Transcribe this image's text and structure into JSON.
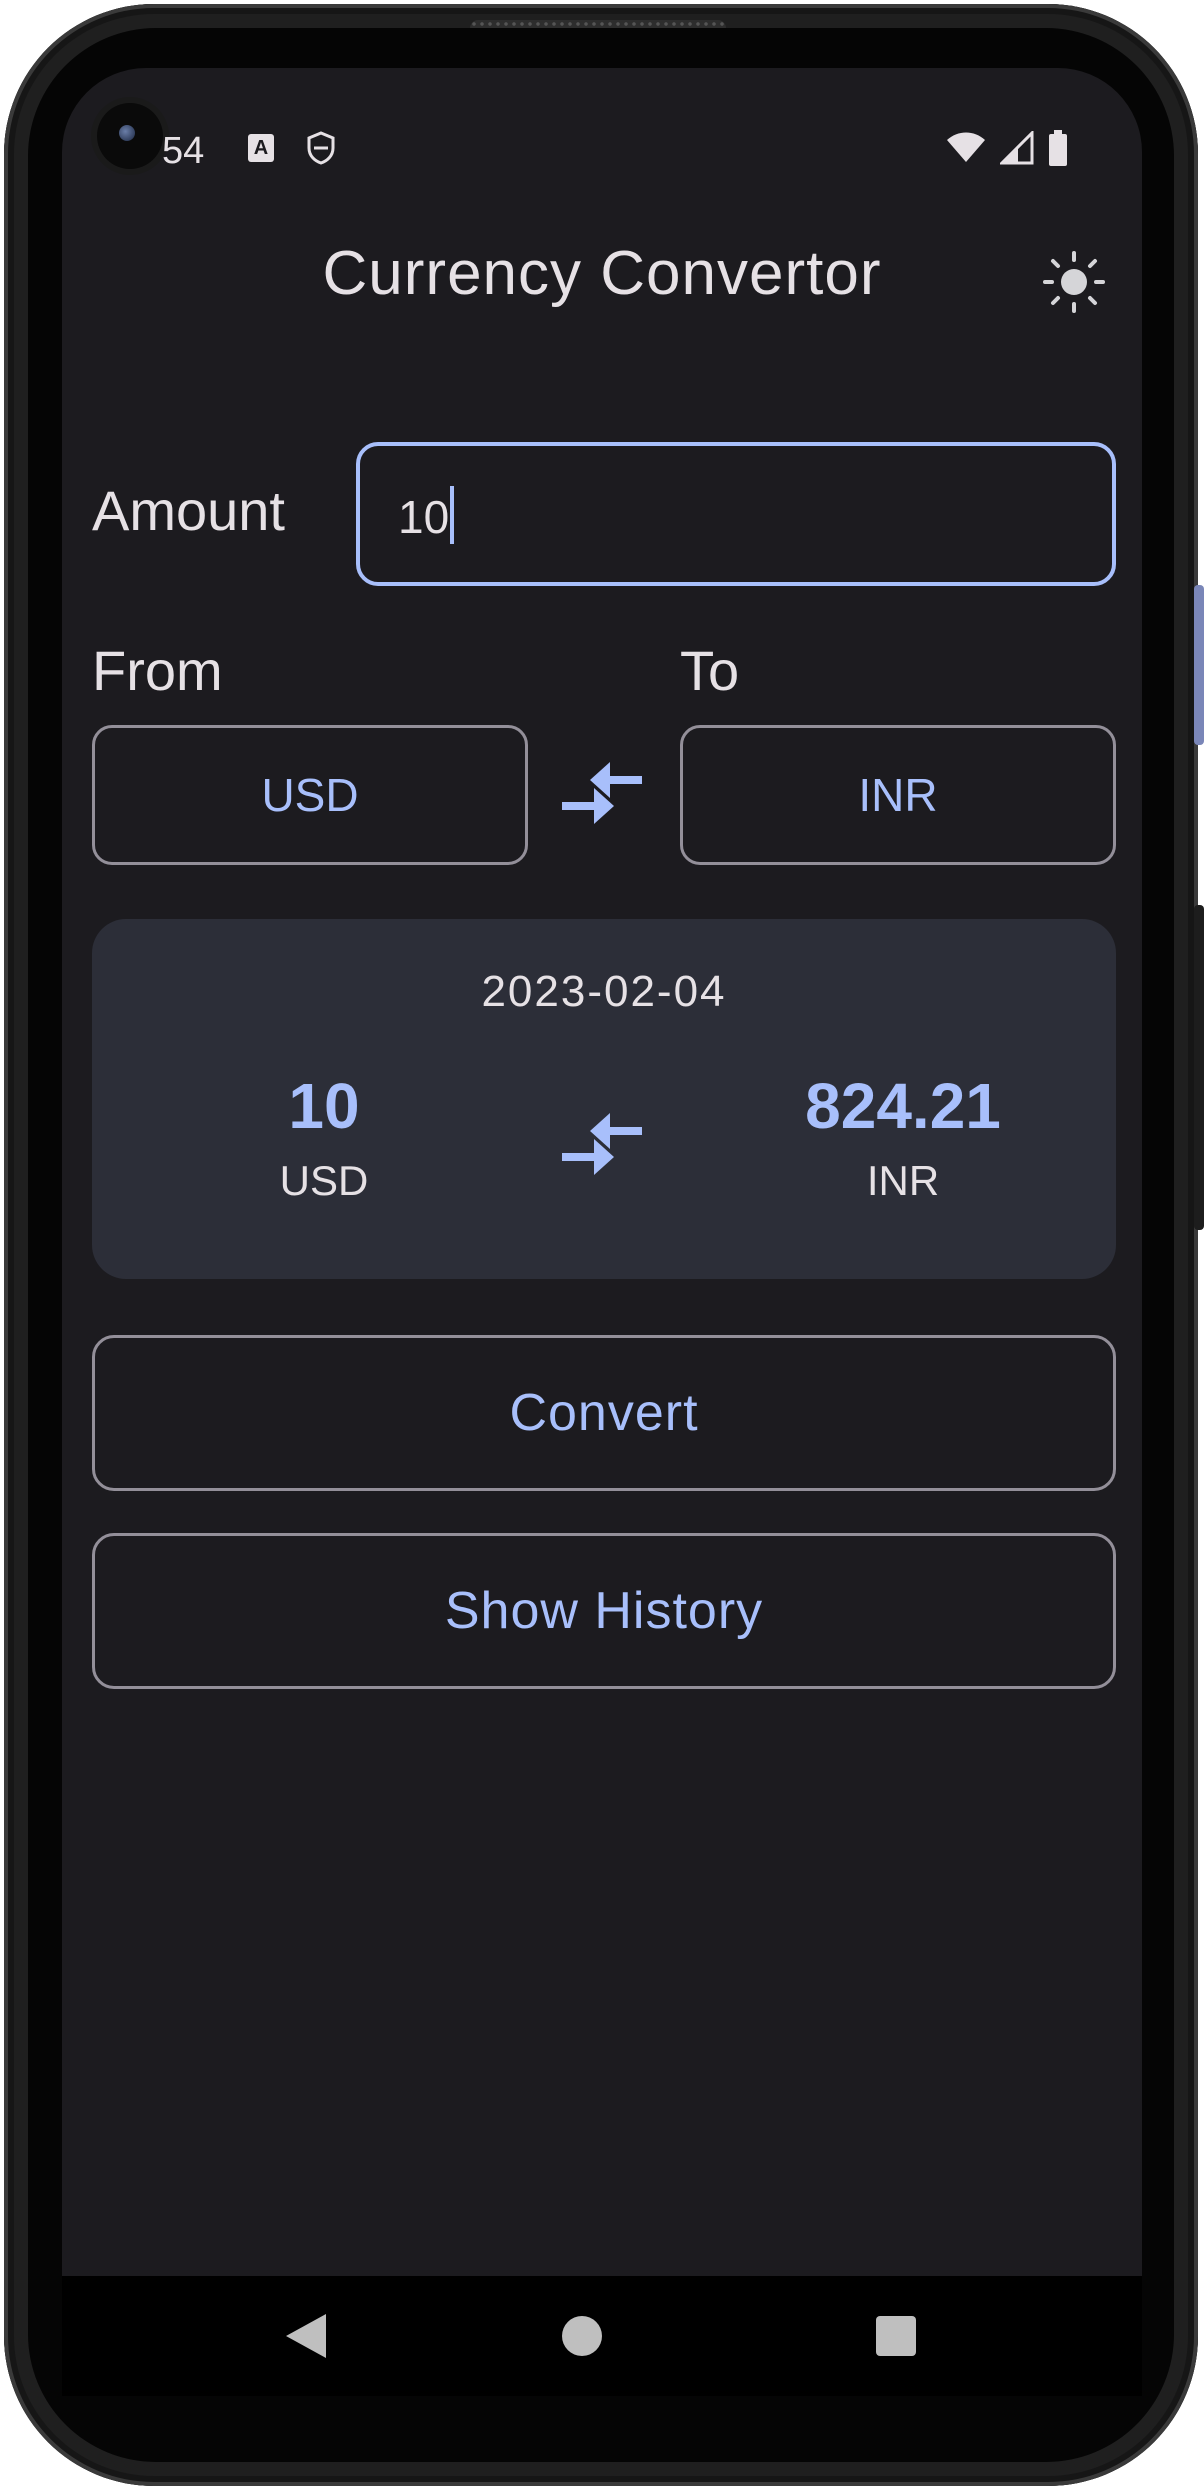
{
  "status_bar": {
    "time": "54",
    "notification_icon_letter": "A",
    "icons": [
      "keyboard-a-icon",
      "shield-icon",
      "wifi-icon",
      "signal-icon",
      "battery-icon"
    ]
  },
  "header": {
    "title": "Currency Convertor",
    "theme_icon": "sun-icon"
  },
  "form": {
    "amount_label": "Amount",
    "amount_value": "10",
    "from_label": "From",
    "to_label": "To",
    "from_currency": "USD",
    "to_currency": "INR"
  },
  "result": {
    "date": "2023-02-04",
    "from_amount": "10",
    "from_currency": "USD",
    "to_amount": "824.21",
    "to_currency": "INR"
  },
  "actions": {
    "convert_label": "Convert",
    "history_label": "Show History"
  },
  "colors": {
    "accent": "#a8bffb",
    "background": "#1c1b1f",
    "card": "#2c2e38",
    "text": "#e6e1e5",
    "outline": "#938f99"
  }
}
